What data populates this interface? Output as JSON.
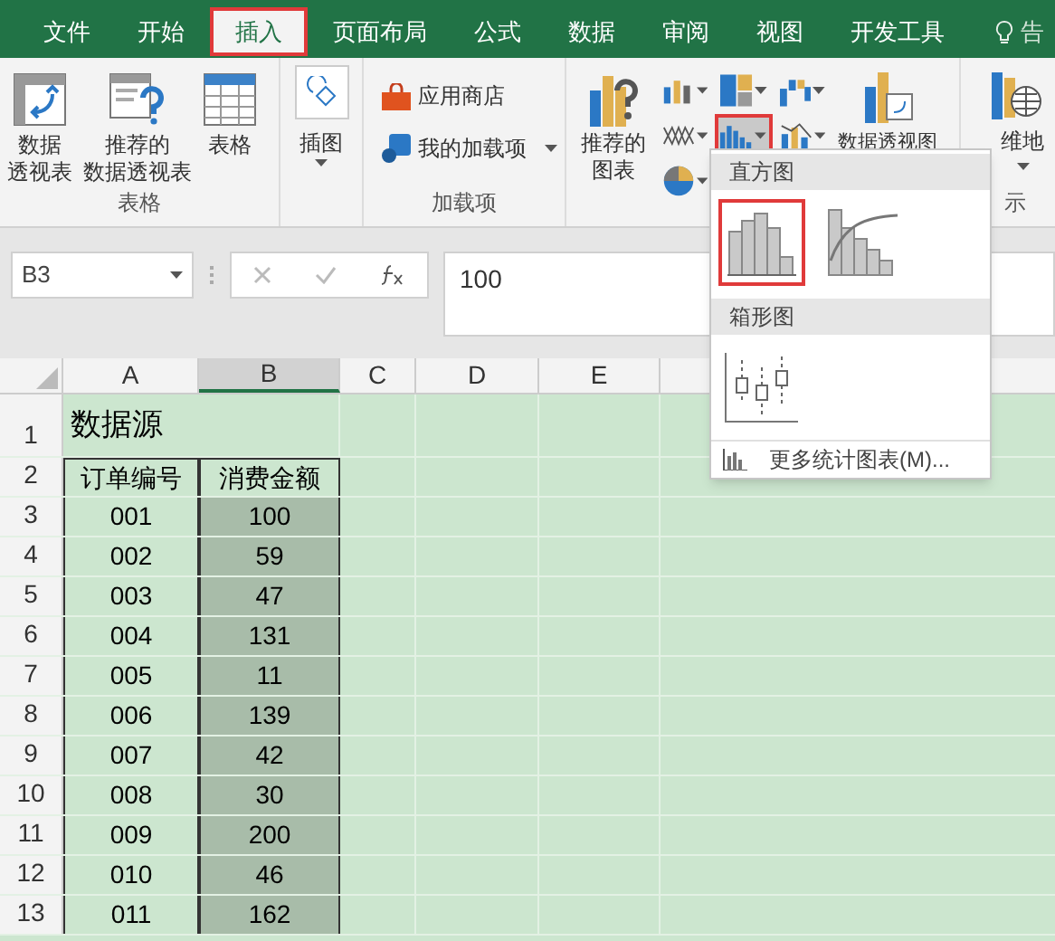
{
  "tabs": [
    {
      "label": "文件",
      "selected": false
    },
    {
      "label": "开始",
      "selected": false
    },
    {
      "label": "插入",
      "selected": true
    },
    {
      "label": "页面布局",
      "selected": false
    },
    {
      "label": "公式",
      "selected": false
    },
    {
      "label": "数据",
      "selected": false
    },
    {
      "label": "审阅",
      "selected": false
    },
    {
      "label": "视图",
      "selected": false
    },
    {
      "label": "开发工具",
      "selected": false
    }
  ],
  "tell_me": "告",
  "ribbon": {
    "table_group": {
      "label": "表格",
      "items": [
        {
          "kind": "pivot",
          "lines": [
            "数据",
            "透视表"
          ]
        },
        {
          "kind": "recommended_pivot",
          "lines": [
            "推荐的",
            "数据透视表"
          ]
        },
        {
          "kind": "table",
          "lines": [
            "表格"
          ]
        }
      ]
    },
    "illustrations": {
      "label": "插图"
    },
    "addins_group": {
      "label": "加载项",
      "items": [
        {
          "kind": "store",
          "label": "应用商店"
        },
        {
          "kind": "my_addins",
          "label": "我的加载项"
        }
      ]
    },
    "charts_group": {
      "recommended": [
        "推荐的",
        "图表"
      ],
      "buttons": [
        {
          "kind": "column",
          "selected": false
        },
        {
          "kind": "hierarchy",
          "selected": false
        },
        {
          "kind": "waterfall",
          "selected": false
        },
        {
          "kind": "line",
          "selected": false
        },
        {
          "kind": "statistic",
          "selected": true
        },
        {
          "kind": "combo",
          "selected": false
        },
        {
          "kind": "pie",
          "selected": false
        }
      ],
      "pivot_chart": "数据透视图"
    },
    "tours_group": {
      "line_1": "维地",
      "label": "示"
    }
  },
  "formula_bar": {
    "name_box": "B3",
    "formula": "100"
  },
  "sheet": {
    "columns": [
      {
        "label": "A",
        "selected": false
      },
      {
        "label": "B",
        "selected": true
      },
      {
        "label": "C",
        "selected": false
      },
      {
        "label": "D",
        "selected": false
      },
      {
        "label": "E",
        "selected": false
      }
    ],
    "rows": [
      {
        "header": "1",
        "selected": false,
        "cells": [
          "数据源"
        ]
      },
      {
        "header": "2",
        "selected": false,
        "cells": [
          "订单编号",
          "消费金额"
        ]
      },
      {
        "header": "3",
        "selected": true,
        "cells": [
          "001",
          "100"
        ]
      },
      {
        "header": "4",
        "selected": true,
        "cells": [
          "002",
          "59"
        ]
      },
      {
        "header": "5",
        "selected": true,
        "cells": [
          "003",
          "47"
        ]
      },
      {
        "header": "6",
        "selected": true,
        "cells": [
          "004",
          "131"
        ]
      },
      {
        "header": "7",
        "selected": true,
        "cells": [
          "005",
          "11"
        ]
      },
      {
        "header": "8",
        "selected": true,
        "cells": [
          "006",
          "139"
        ]
      },
      {
        "header": "9",
        "selected": true,
        "cells": [
          "007",
          "42"
        ]
      },
      {
        "header": "10",
        "selected": true,
        "cells": [
          "008",
          "30"
        ]
      },
      {
        "header": "11",
        "selected": true,
        "cells": [
          "009",
          "200"
        ]
      },
      {
        "header": "12",
        "selected": true,
        "cells": [
          "010",
          "46"
        ]
      },
      {
        "header": "13",
        "selected": true,
        "cells": [
          "011",
          "162"
        ]
      }
    ]
  },
  "dropdown": {
    "sections": [
      {
        "title": "直方图",
        "options": [
          {
            "kind": "histogram",
            "selected": true
          },
          {
            "kind": "pareto",
            "selected": false
          }
        ]
      },
      {
        "title": "箱形图",
        "options": [
          {
            "kind": "box_whisker",
            "selected": false
          }
        ]
      }
    ],
    "more": "更多统计图表(M)..."
  }
}
